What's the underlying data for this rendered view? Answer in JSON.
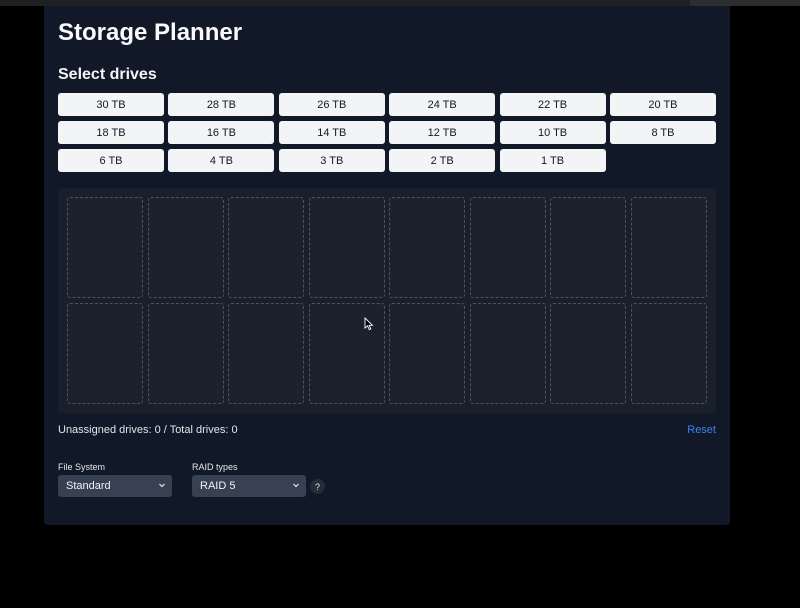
{
  "app": {
    "title": "Storage Planner"
  },
  "drives": {
    "heading": "Select drives",
    "options": [
      "30 TB",
      "28 TB",
      "26 TB",
      "24 TB",
      "22 TB",
      "20 TB",
      "18 TB",
      "16 TB",
      "14 TB",
      "12 TB",
      "10 TB",
      "8 TB",
      "6 TB",
      "4 TB",
      "3 TB",
      "2 TB",
      "1 TB"
    ]
  },
  "bays": {
    "count": 16,
    "filled": 0
  },
  "summary": {
    "text": "Unassigned drives: 0 / Total drives: 0",
    "reset_label": "Reset"
  },
  "settings": {
    "file_system_label": "File System",
    "file_system_value": "Standard",
    "raid_label": "RAID types",
    "raid_value": "RAID 5",
    "help_label": "?"
  },
  "colors": {
    "accent": "#3b82f6",
    "panel": "#111827",
    "button": "#f3f4f6"
  }
}
